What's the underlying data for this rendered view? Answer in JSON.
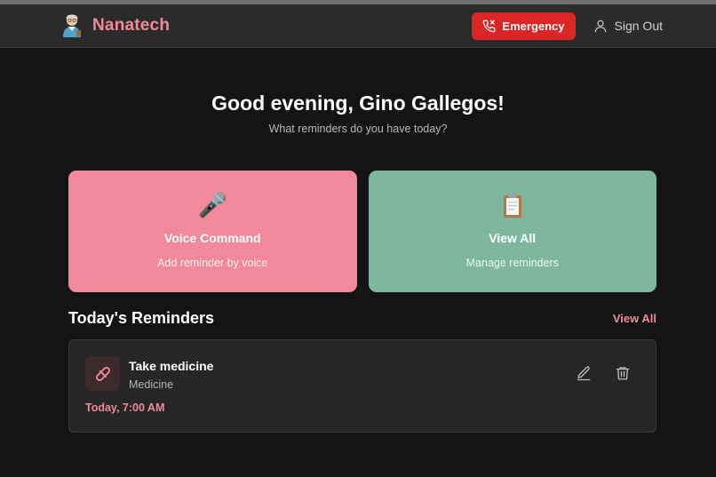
{
  "header": {
    "brand": "Nanatech",
    "emergency_label": "Emergency",
    "signout_label": "Sign Out"
  },
  "greeting": {
    "title": "Good evening, Gino Gallegos!",
    "subtitle": "What reminders do you have today?"
  },
  "cards": [
    {
      "icon": "microphone-icon",
      "glyph": "🎤",
      "title": "Voice Command",
      "subtitle": "Add reminder by voice",
      "color": "#f2899a"
    },
    {
      "icon": "clipboard-icon",
      "title": "View All",
      "subtitle": "Manage reminders",
      "color": "#7eb6a0"
    }
  ],
  "reminders_section": {
    "title": "Today's Reminders",
    "view_all_label": "View All"
  },
  "reminders": [
    {
      "icon": "pill-icon",
      "title": "Take medicine",
      "category": "Medicine",
      "time": "Today, 7:00 AM"
    }
  ],
  "colors": {
    "accent": "#f2899a",
    "emergency": "#dc2626",
    "viewall_card": "#7eb6a0",
    "background": "#141414"
  }
}
